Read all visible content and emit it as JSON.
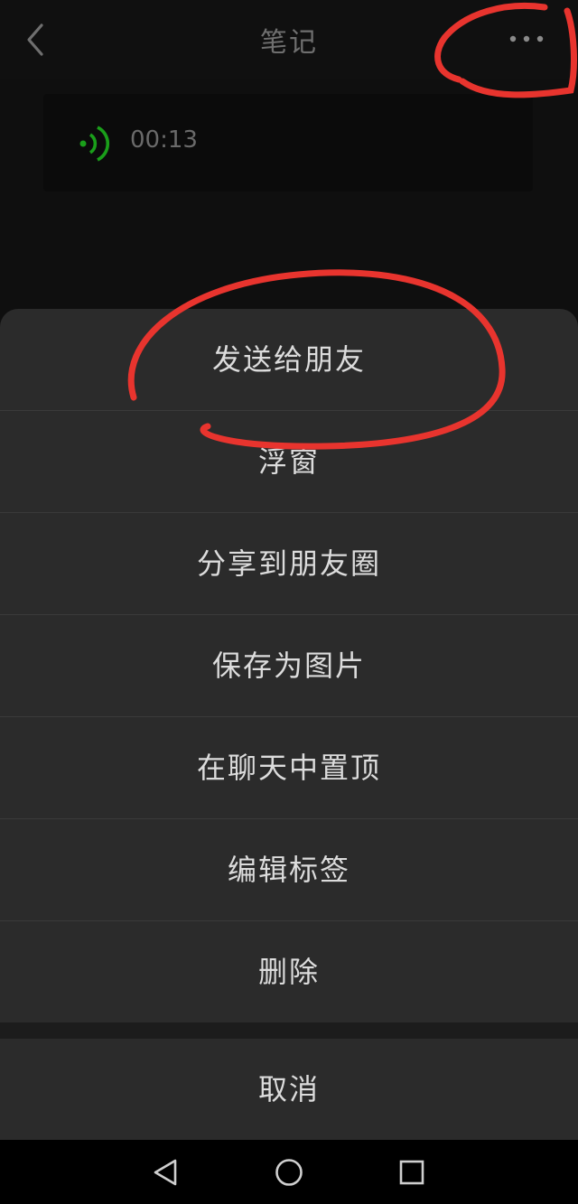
{
  "header": {
    "title": "笔记"
  },
  "voice_note": {
    "duration": "00:13"
  },
  "menu": {
    "items": [
      {
        "label": "发送给朋友"
      },
      {
        "label": "浮窗"
      },
      {
        "label": "分享到朋友圈"
      },
      {
        "label": "保存为图片"
      },
      {
        "label": "在聊天中置顶"
      },
      {
        "label": "编辑标签"
      },
      {
        "label": "删除"
      }
    ],
    "cancel": "取消"
  },
  "colors": {
    "background": "#0f0f0f",
    "sheet": "#2b2b2b",
    "voice_accent": "#1a9e1a",
    "annotation": "#e8342e"
  },
  "icons": {
    "back": "chevron-left-icon",
    "more": "more-icon",
    "voice": "voice-wave-icon",
    "nav_back": "triangle-back-icon",
    "nav_home": "circle-home-icon",
    "nav_recent": "square-recent-icon"
  }
}
